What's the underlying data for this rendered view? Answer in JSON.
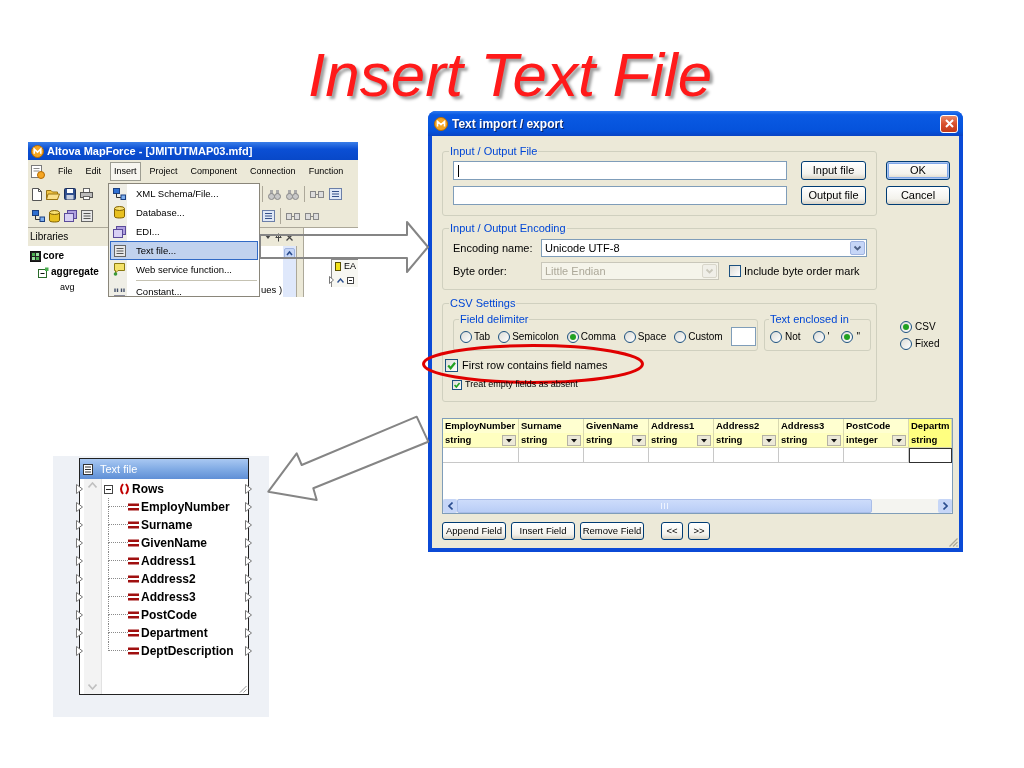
{
  "slide": {
    "title": "Insert Text File"
  },
  "app_window": {
    "title": "Altova MapForce - [JMITUTMAP03.mfd]",
    "menu_bar": [
      {
        "label": "File",
        "selected": false
      },
      {
        "label": "Edit",
        "selected": false
      },
      {
        "label": "Insert",
        "selected": true
      },
      {
        "label": "Project",
        "selected": false
      },
      {
        "label": "Component",
        "selected": false
      },
      {
        "label": "Connection",
        "selected": false
      },
      {
        "label": "Function",
        "selected": false
      }
    ],
    "insert_menu": [
      {
        "label": "XML Schema/File...",
        "selected": false,
        "separator_before": false
      },
      {
        "label": "Database...",
        "selected": false,
        "separator_before": false
      },
      {
        "label": "EDI...",
        "selected": false,
        "separator_before": false
      },
      {
        "label": "Text file...",
        "selected": true,
        "separator_before": false
      },
      {
        "label": "Web service function...",
        "selected": false,
        "separator_before": false
      },
      {
        "label": "Constant...",
        "selected": false,
        "separator_before": true
      }
    ],
    "libraries": {
      "title": "Libraries",
      "tree": [
        {
          "label": "core",
          "children": [
            {
              "label": "aggregate",
              "expanded": true,
              "children": [
                {
                  "label": "avg"
                }
              ]
            }
          ]
        }
      ],
      "row_tail": "ues )"
    },
    "canvas_component": {
      "title": "EA"
    }
  },
  "dialog": {
    "title": "Text import / export",
    "file_group": {
      "label": "Input / Output File",
      "fields": [
        {
          "focused": true,
          "button": "Input file"
        },
        {
          "focused": false,
          "button": "Output file"
        }
      ]
    },
    "side_buttons": [
      {
        "label": "OK",
        "default": true
      },
      {
        "label": "Cancel",
        "default": false
      }
    ],
    "encoding_group": {
      "label": "Input / Output Encoding",
      "encoding_name": {
        "label": "Encoding name:",
        "value": "Unicode UTF-8",
        "disabled": false
      },
      "byte_order": {
        "label": "Byte order:",
        "value": "Little Endian",
        "disabled": true
      },
      "byte_order_mark": {
        "label": "Include byte order mark",
        "checked": false
      }
    },
    "csv_group": {
      "label": "CSV Settings",
      "field_delimiter": {
        "label": "Field delimiter",
        "options": [
          {
            "label": "Tab",
            "selected": false
          },
          {
            "label": "Semicolon",
            "selected": false
          },
          {
            "label": "Comma",
            "selected": true
          },
          {
            "label": "Space",
            "selected": false
          },
          {
            "label": "Custom",
            "selected": false
          }
        ]
      },
      "text_enclosed_in": {
        "label": "Text enclosed in",
        "options": [
          {
            "label": "Not",
            "selected": false
          },
          {
            "label": "'",
            "selected": false
          },
          {
            "label": "\"",
            "selected": true
          }
        ]
      },
      "checkboxes": [
        {
          "label": "First row contains field names",
          "checked": true,
          "circled": true
        },
        {
          "label": "Treat empty fields as absent",
          "checked": true,
          "circled": false
        }
      ]
    },
    "format_options": [
      {
        "label": "CSV",
        "selected": true
      },
      {
        "label": "Fixed",
        "selected": false
      }
    ],
    "fields_table": {
      "columns": [
        {
          "name": "EmployNumber",
          "type": "string",
          "selected": false
        },
        {
          "name": "Surname",
          "type": "string",
          "selected": false
        },
        {
          "name": "GivenName",
          "type": "string",
          "selected": false
        },
        {
          "name": "Address1",
          "type": "string",
          "selected": false
        },
        {
          "name": "Address2",
          "type": "string",
          "selected": false
        },
        {
          "name": "Address3",
          "type": "string",
          "selected": false
        },
        {
          "name": "PostCode",
          "type": "integer",
          "selected": false
        },
        {
          "name": "Departm",
          "type": "string",
          "selected": true
        }
      ]
    },
    "table_buttons": [
      "Append Field",
      "Insert Field",
      "Remove Field",
      "<<",
      ">>"
    ]
  },
  "text_file_component": {
    "title": "Text file",
    "tree": [
      {
        "label": "Rows",
        "expanded": true,
        "children": [
          {
            "label": "EmployNumber"
          },
          {
            "label": "Surname"
          },
          {
            "label": "GivenName"
          },
          {
            "label": "Address1"
          },
          {
            "label": "Address2"
          },
          {
            "label": "Address3"
          },
          {
            "label": "PostCode"
          },
          {
            "label": "Department"
          },
          {
            "label": "DeptDescription"
          }
        ]
      }
    ]
  }
}
